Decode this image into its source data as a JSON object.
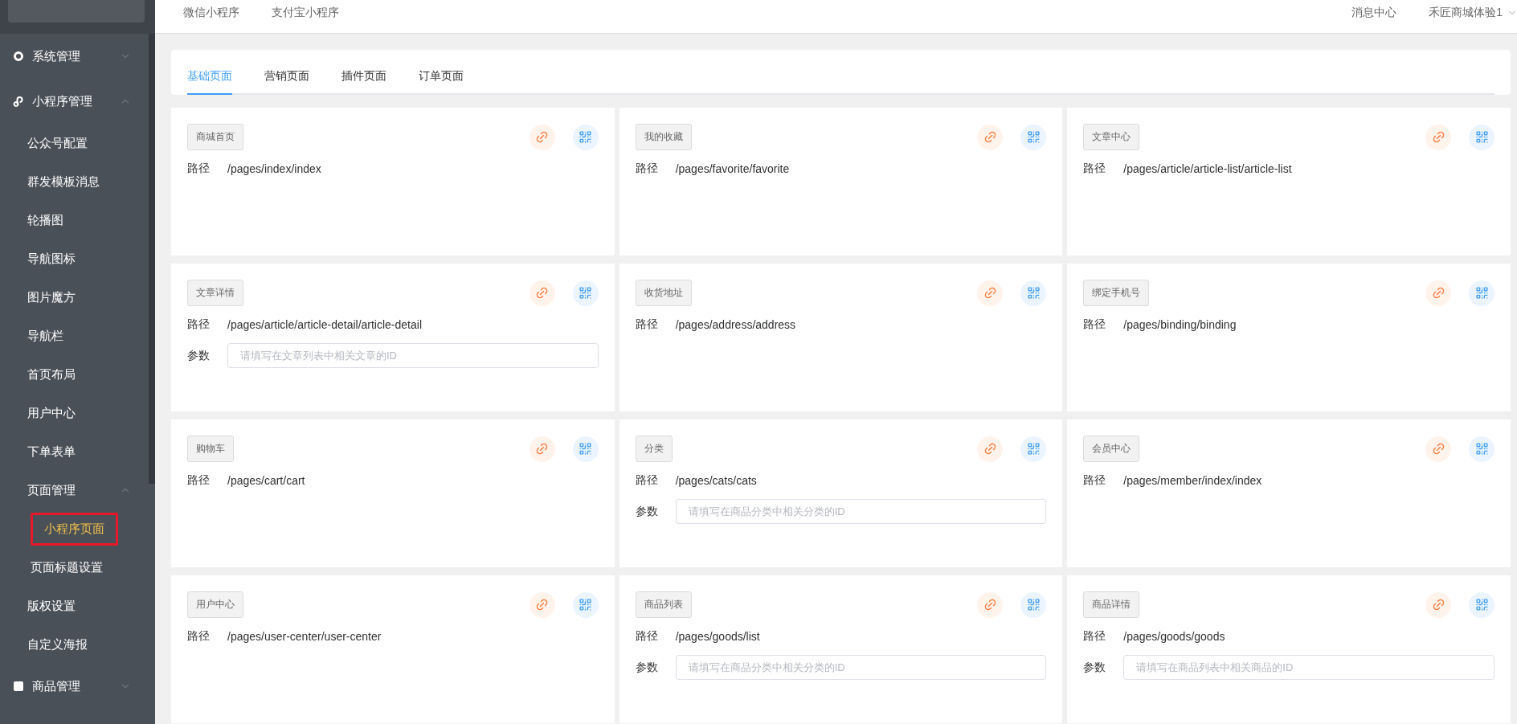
{
  "sidebar": {
    "items": [
      {
        "label": "系统管理",
        "kind": "ring",
        "expanded": false,
        "selected": false
      },
      {
        "label": "小程序管理",
        "kind": "curl",
        "expanded": true,
        "selected": false,
        "children": [
          {
            "label": "公众号配置",
            "selected": false
          },
          {
            "label": "群发模板消息",
            "selected": false
          },
          {
            "label": "轮播图",
            "selected": false
          },
          {
            "label": "导航图标",
            "selected": false
          },
          {
            "label": "图片魔方",
            "selected": false
          },
          {
            "label": "导航栏",
            "selected": false
          },
          {
            "label": "首页布局",
            "selected": false
          },
          {
            "label": "用户中心",
            "selected": false
          },
          {
            "label": "下单表单",
            "selected": false
          },
          {
            "label": "页面管理",
            "expanded": true,
            "selected": false,
            "children": [
              {
                "label": "小程序页面",
                "selected": true
              },
              {
                "label": "页面标题设置",
                "selected": false
              }
            ]
          },
          {
            "label": "版权设置",
            "selected": false
          },
          {
            "label": "自定义海报",
            "selected": false
          }
        ]
      },
      {
        "label": "商品管理",
        "kind": "square",
        "expanded": false,
        "selected": false
      }
    ]
  },
  "top_nav": {
    "links": [
      "微信小程序",
      "支付宝小程序"
    ],
    "messages": "消息中心",
    "user": "禾匠商城体验1"
  },
  "tabs": [
    {
      "label": "基础页面",
      "selected": true
    },
    {
      "label": "营销页面",
      "selected": false
    },
    {
      "label": "插件页面",
      "selected": false
    },
    {
      "label": "订单页面",
      "selected": false
    }
  ],
  "cards": [
    {
      "title": "商城首页",
      "path_label": "路径",
      "path": "/pages/index/index"
    },
    {
      "title": "我的收藏",
      "path_label": "路径",
      "path": "/pages/favorite/favorite"
    },
    {
      "title": "文章中心",
      "path_label": "路径",
      "path": "/pages/article/article-list/article-list"
    },
    {
      "title": "文章详情",
      "path_label": "路径",
      "path": "/pages/article/article-detail/article-detail",
      "param_label": "参数",
      "param_placeholder": "请填写在文章列表中相关文章的ID"
    },
    {
      "title": "收货地址",
      "path_label": "路径",
      "path": "/pages/address/address"
    },
    {
      "title": "绑定手机号",
      "path_label": "路径",
      "path": "/pages/binding/binding"
    },
    {
      "title": "购物车",
      "path_label": "路径",
      "path": "/pages/cart/cart"
    },
    {
      "title": "分类",
      "path_label": "路径",
      "path": "/pages/cats/cats",
      "param_label": "参数",
      "param_placeholder": "请填写在商品分类中相关分类的ID"
    },
    {
      "title": "会员中心",
      "path_label": "路径",
      "path": "/pages/member/index/index"
    },
    {
      "title": "用户中心",
      "path_label": "路径",
      "path": "/pages/user-center/user-center"
    },
    {
      "title": "商品列表",
      "path_label": "路径",
      "path": "/pages/goods/list",
      "param_label": "参数",
      "param_placeholder": "请填写在商品分类中相关分类的ID"
    },
    {
      "title": "商品详情",
      "path_label": "路径",
      "path": "/pages/goods/goods",
      "param_label": "参数",
      "param_placeholder": "请填写在商品列表中相关商品的ID"
    }
  ]
}
